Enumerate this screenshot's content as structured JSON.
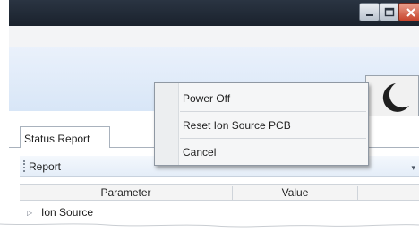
{
  "context_menu": {
    "items": [
      "Power Off",
      "Reset Ion Source PCB",
      "Cancel"
    ]
  },
  "tabs": [
    "Status Report"
  ],
  "toolbar": {
    "label": "Report"
  },
  "grid": {
    "columns": [
      "Parameter",
      "Value"
    ],
    "rows": [
      {
        "label": "Ion Source"
      }
    ]
  },
  "icons": {
    "minimize": "minimize-icon",
    "maximize": "maximize-icon",
    "close": "close-icon",
    "status": "crescent-icon",
    "expander": "expand-triangle-icon"
  }
}
